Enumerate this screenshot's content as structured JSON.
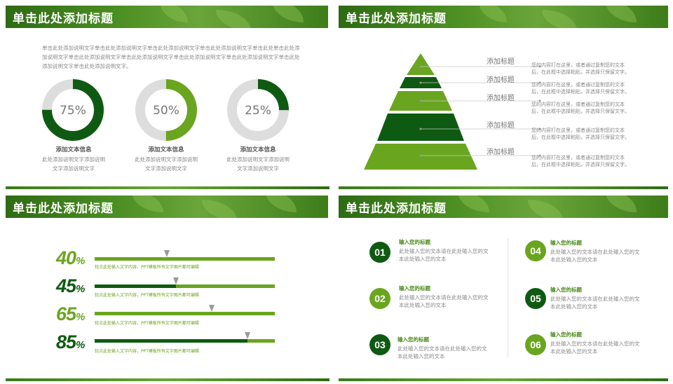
{
  "colors": {
    "dark_green": "#0f5a12",
    "mid_green": "#1a6e1c",
    "light_green": "#6aa51f",
    "grey": "#dddddd"
  },
  "slides": [
    {
      "title": "单击此处添加标题",
      "description": "单击此处添加说明文字单击此处添加说明文字单击此处添加说明文字单击此处添加说明文字单击此处单击此处添加说明文字单击此处添加说明文字单击此处添加说明文字单击此处添加说明文字单击此处添加说明文字单击此处添加说明文字单击此处添加说明文字。",
      "donuts": [
        {
          "value": 75,
          "label": "75%",
          "color": "#0f5a12",
          "title": "添加文本信息",
          "text": "此处添加说明文字添加说明文字添加说明文字"
        },
        {
          "value": 50,
          "label": "50%",
          "color": "#6aa51f",
          "title": "添加文本信息",
          "text": "此处添加说明文字添加说明文字添加说明文字"
        },
        {
          "value": 25,
          "label": "25%",
          "color": "#0f5a12",
          "title": "添加文本信息",
          "text": "此处添加说明文字添加说明文字添加说明文字"
        }
      ]
    },
    {
      "title": "单击此处添加标题",
      "levels": [
        {
          "label": "添加标题",
          "text": "您的内容打在这里，或者通过复制您的文本后，在此框中选择粘贴，并选择只保留文字。",
          "color": "#6aa51f"
        },
        {
          "label": "添加标题",
          "text": "您的内容打在这里，或者通过复制您的文本后，在此框中选择粘贴，并选择只保留文字。",
          "color": "#0f5a12"
        },
        {
          "label": "添加标题",
          "text": "您的内容打在这里，或者通过复制您的文本后，在此框中选择粘贴，并选择只保留文字。",
          "color": "#6aa51f"
        },
        {
          "label": "添加标题",
          "text": "您的内容打在这里，或者通过复制您的文本后，在此框中选择粘贴，并选择只保留文字。",
          "color": "#0f5a12"
        },
        {
          "label": "添加标题",
          "text": "您的内容打在这里，或者通过复制您的文本后，在此框中选择粘贴，并选择只保留文字。",
          "color": "#6aa51f"
        }
      ]
    },
    {
      "title": "单击此处添加标题",
      "bars": [
        {
          "label": "40",
          "unit": "%",
          "value": 40,
          "color": "#6aa51f",
          "note": "轻点此处输入文字内容，PPT模板所有文字图片都可编辑"
        },
        {
          "label": "45",
          "unit": "%",
          "value": 45,
          "color": "#0f5a12",
          "note": "轻点此处输入文字内容，PPT模板所有文字图片都可编辑"
        },
        {
          "label": "65",
          "unit": "%",
          "value": 65,
          "color": "#6aa51f",
          "note": "轻点此处输入文字内容，PPT模板所有文字图片都可编辑"
        },
        {
          "label": "85",
          "unit": "%",
          "value": 85,
          "color": "#0f5a12",
          "note": "轻点此处输入文字内容，PPT模板所有文字图片都可编辑"
        }
      ]
    },
    {
      "title": "单击此处添加标题",
      "items": [
        {
          "num": "01",
          "color": "#0f5a12",
          "title": "输入您的标题",
          "text": "此处输入您的文本请在此处输入您的文本此处输入您的文本"
        },
        {
          "num": "02",
          "color": "#6aa51f",
          "title": "输入您的标题",
          "text": "此处输入您的文本请在此处输入您的文本此处输入您的文本"
        },
        {
          "num": "03",
          "color": "#0f5a12",
          "title": "输入您的标题",
          "text": "此处输入您的文本请在此处输入您的文本此处输入您的文本"
        },
        {
          "num": "04",
          "color": "#6aa51f",
          "title": "输入您的标题",
          "text": "此处输入您的文本请在此处输入您的文本此处输入您的文本"
        },
        {
          "num": "05",
          "color": "#0f5a12",
          "title": "输入您的标题",
          "text": "此处输入您的文本请在此处输入您的文本此处输入您的文本"
        },
        {
          "num": "06",
          "color": "#6aa51f",
          "title": "输入您的标题",
          "text": "此处输入您的文本请在此处输入您的文本此处输入您的文本"
        }
      ]
    }
  ]
}
